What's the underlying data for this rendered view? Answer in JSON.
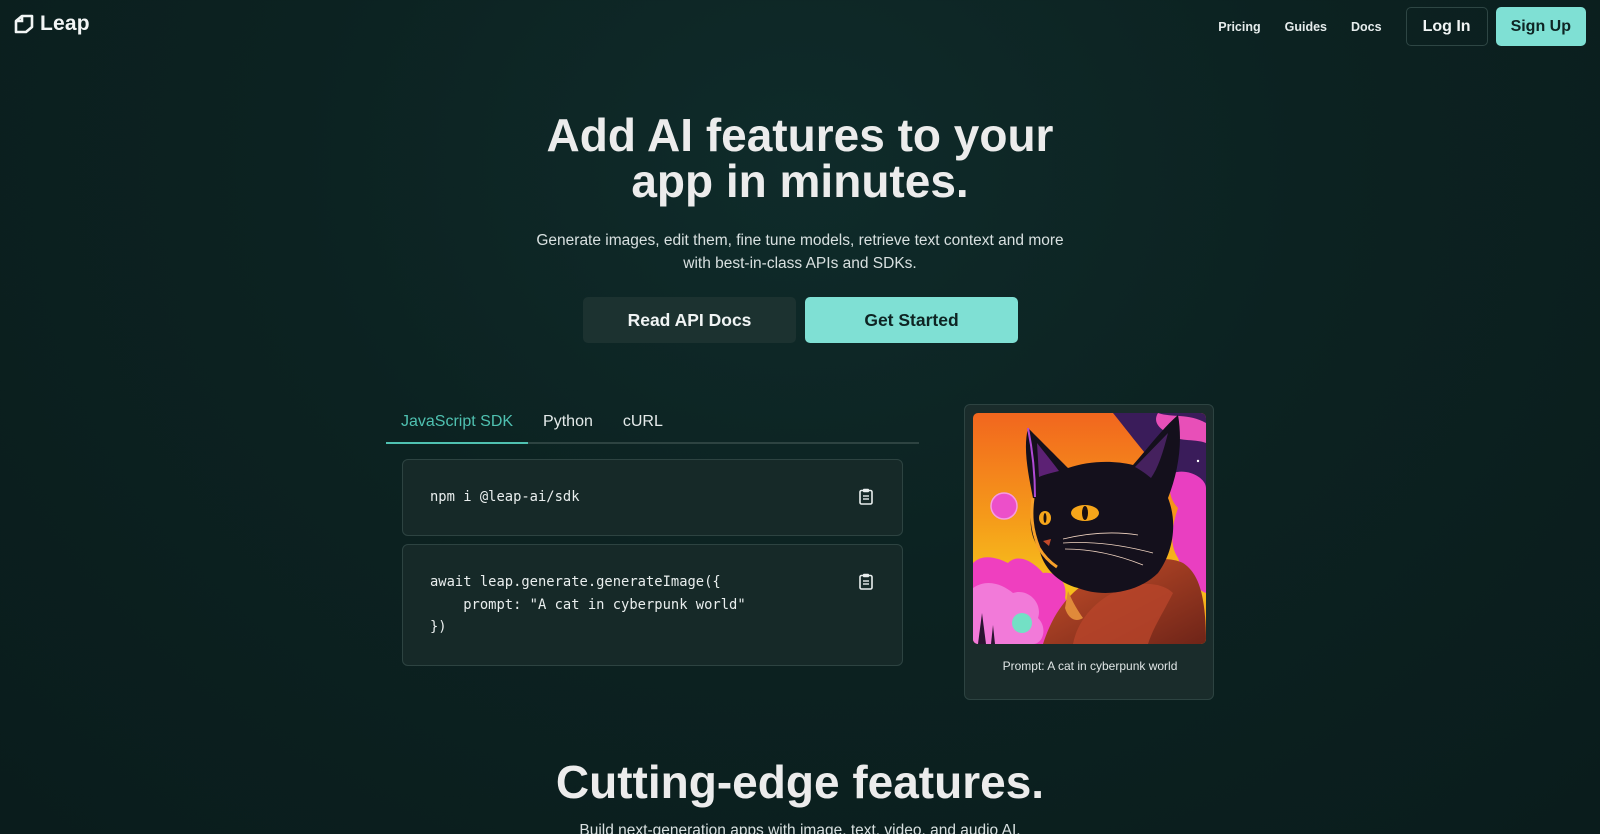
{
  "nav": {
    "brand": "Leap",
    "links": [
      "Pricing",
      "Guides",
      "Docs"
    ],
    "login_label": "Log In",
    "signup_label": "Sign Up"
  },
  "hero": {
    "title_line1": "Add AI features to your",
    "title_line2": "app in minutes.",
    "subtitle_line1": "Generate images, edit them, fine tune models, retrieve text context and more",
    "subtitle_line2": "with best-in-class APIs and SDKs.",
    "docs_button": "Read API Docs",
    "start_button": "Get Started"
  },
  "code": {
    "tabs": [
      "JavaScript SDK",
      "Python",
      "cURL"
    ],
    "active_tab": "JavaScript SDK",
    "install_cmd": "npm i @leap-ai/sdk",
    "snippet": "await leap.generate.generateImage({\n    prompt: \"A cat in cyberpunk world\"\n})"
  },
  "example": {
    "caption": "Prompt: A cat in cyberpunk world"
  },
  "features": {
    "title": "Cutting-edge features.",
    "subtitle": "Build next-generation apps with image, text, video, and audio AI."
  },
  "colors": {
    "accent": "#7fe0d4",
    "tab_active": "#4fc1b1",
    "background": "#0c2221"
  }
}
